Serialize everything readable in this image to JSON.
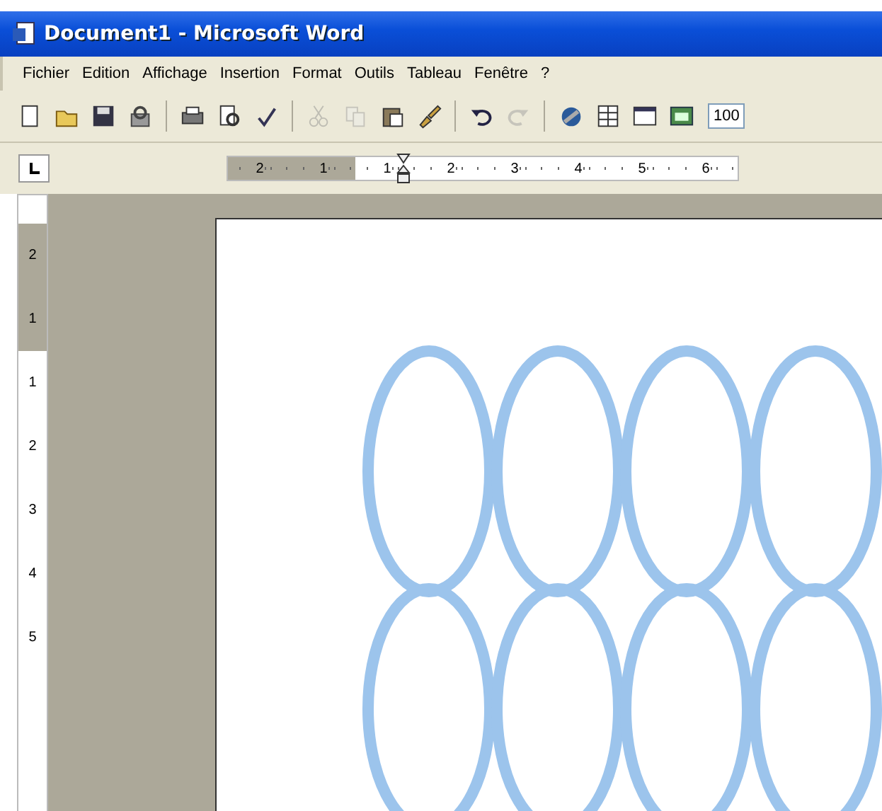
{
  "window": {
    "title": "Document1 - Microsoft Word"
  },
  "menu": [
    "Fichier",
    "Edition",
    "Affichage",
    "Insertion",
    "Format",
    "Outils",
    "Tableau",
    "Fenêtre",
    "?"
  ],
  "toolbar": [
    {
      "kind": "new",
      "disabled": false
    },
    {
      "kind": "open",
      "disabled": false
    },
    {
      "kind": "save",
      "disabled": false
    },
    {
      "kind": "permission",
      "disabled": false
    },
    {
      "kind": "sep"
    },
    {
      "kind": "print",
      "disabled": false
    },
    {
      "kind": "preview",
      "disabled": false
    },
    {
      "kind": "spelling",
      "disabled": false
    },
    {
      "kind": "sep"
    },
    {
      "kind": "cut",
      "disabled": true
    },
    {
      "kind": "copy",
      "disabled": true
    },
    {
      "kind": "paste",
      "disabled": false
    },
    {
      "kind": "brush",
      "disabled": false
    },
    {
      "kind": "sep"
    },
    {
      "kind": "undo",
      "disabled": false
    },
    {
      "kind": "redo",
      "disabled": true
    },
    {
      "kind": "sep"
    },
    {
      "kind": "hyperlink",
      "disabled": false
    },
    {
      "kind": "table",
      "disabled": false
    },
    {
      "kind": "window",
      "disabled": false
    },
    {
      "kind": "sheet",
      "disabled": false
    }
  ],
  "zoom": {
    "value": "100"
  },
  "horizontal_ruler": [
    {
      "label": "2",
      "margin": true
    },
    {
      "label": "1",
      "margin": true
    },
    {
      "label": "1",
      "margin": false
    },
    {
      "label": "2",
      "margin": false
    },
    {
      "label": "3",
      "margin": false
    },
    {
      "label": "4",
      "margin": false
    },
    {
      "label": "5",
      "margin": false
    },
    {
      "label": "6",
      "margin": false
    }
  ],
  "vertical_ruler": [
    {
      "label": "2",
      "margin": true
    },
    {
      "label": "1",
      "margin": true
    },
    {
      "label": "1",
      "margin": false
    },
    {
      "label": "2",
      "margin": false
    },
    {
      "label": "3",
      "margin": false
    },
    {
      "label": "4",
      "margin": false
    },
    {
      "label": "5",
      "margin": false
    }
  ],
  "document": {
    "shapes": [
      {
        "kind": "oval"
      },
      {
        "kind": "oval"
      },
      {
        "kind": "oval"
      },
      {
        "kind": "oval"
      },
      {
        "kind": "oval"
      },
      {
        "kind": "oval"
      },
      {
        "kind": "oval"
      },
      {
        "kind": "oval"
      }
    ]
  }
}
